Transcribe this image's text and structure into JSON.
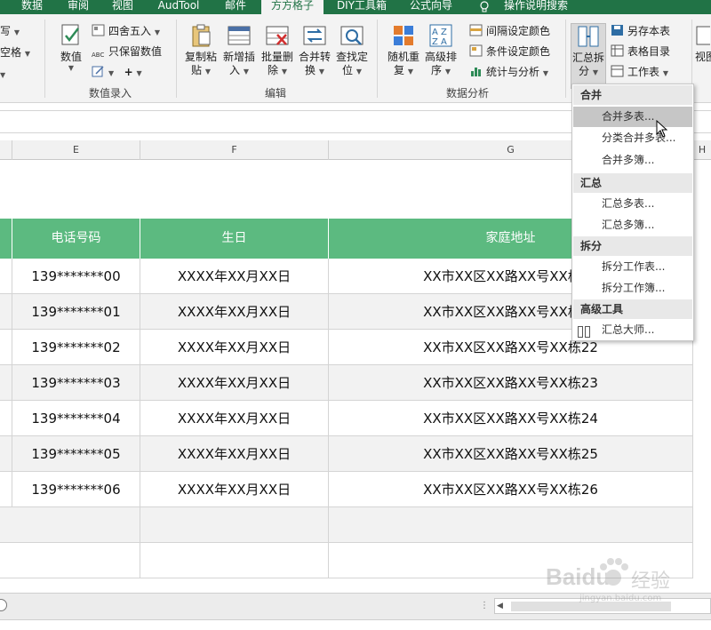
{
  "ribbon_tabs": [
    "数据",
    "审阅",
    "视图",
    "AudTool",
    "邮件",
    "方方格子",
    "DIY工具箱",
    "公式向导",
    "操作说明搜索"
  ],
  "ribbon": {
    "cut_left": {
      "item1": "写",
      "item2": "空格"
    },
    "value_group": {
      "value_label": "数值",
      "round_label": "四舍五入",
      "keep_label": "只保留数值",
      "group_label": "数值录入"
    },
    "edit_group": {
      "copy_paste_1": "复制粘",
      "copy_paste_2": "贴",
      "insert_1": "新增插",
      "insert_2": "入",
      "batch_delete_1": "批量删",
      "batch_delete_2": "除",
      "merge_convert_1": "合并转",
      "merge_convert_2": "换",
      "find_locate_1": "查找定",
      "find_locate_2": "位",
      "group_label": "编辑"
    },
    "analysis_group": {
      "random_1": "随机重",
      "random_2": "复",
      "sort_1": "高级排",
      "sort_2": "序",
      "interval_color": "间隔设定颜色",
      "conditional_color": "条件设定颜色",
      "stats": "统计与分析",
      "group_label": "数据分析"
    },
    "summary_group": {
      "summary_1": "汇总拆",
      "summary_2": "分",
      "save_as": "另存本表",
      "table_index": "表格目录",
      "worksheet": "工作表"
    },
    "view_cut": "视图"
  },
  "columns": [
    "E",
    "F",
    "G",
    "H"
  ],
  "table": {
    "headers": [
      "电话号码",
      "生日",
      "家庭地址"
    ],
    "rows": [
      {
        "phone": "139*******00",
        "birthday": "XXXX年XX月XX日",
        "address": "XX市XX区XX路XX号XX栋20"
      },
      {
        "phone": "139*******01",
        "birthday": "XXXX年XX月XX日",
        "address": "XX市XX区XX路XX号XX栋21"
      },
      {
        "phone": "139*******02",
        "birthday": "XXXX年XX月XX日",
        "address": "XX市XX区XX路XX号XX栋22"
      },
      {
        "phone": "139*******03",
        "birthday": "XXXX年XX月XX日",
        "address": "XX市XX区XX路XX号XX栋23"
      },
      {
        "phone": "139*******04",
        "birthday": "XXXX年XX月XX日",
        "address": "XX市XX区XX路XX号XX栋24"
      },
      {
        "phone": "139*******05",
        "birthday": "XXXX年XX月XX日",
        "address": "XX市XX区XX路XX号XX栋25"
      },
      {
        "phone": "139*******06",
        "birthday": "XXXX年XX月XX日",
        "address": "XX市XX区XX路XX号XX栋26"
      }
    ]
  },
  "menu": {
    "sec_merge": "合并",
    "merge_multi_tables": "合并多表...",
    "classify_merge": "分类合并多表...",
    "merge_multi_books": "合并多簿...",
    "sec_summary": "汇总",
    "summary_multi_tables": "汇总多表...",
    "summary_multi_books": "汇总多簿...",
    "sec_split": "拆分",
    "split_worksheet": "拆分工作表...",
    "split_workbook": "拆分工作簿...",
    "sec_advanced": "高级工具",
    "summary_master": "汇总大师..."
  },
  "watermark": {
    "brand": "Baidu",
    "cn": "经验",
    "url": "jingyan.baidu.com"
  },
  "colors": {
    "excel_green": "#217346",
    "header_green": "#5cba80",
    "row_alt": "#f2f2f2",
    "menu_highlight": "#c6c6c6"
  }
}
